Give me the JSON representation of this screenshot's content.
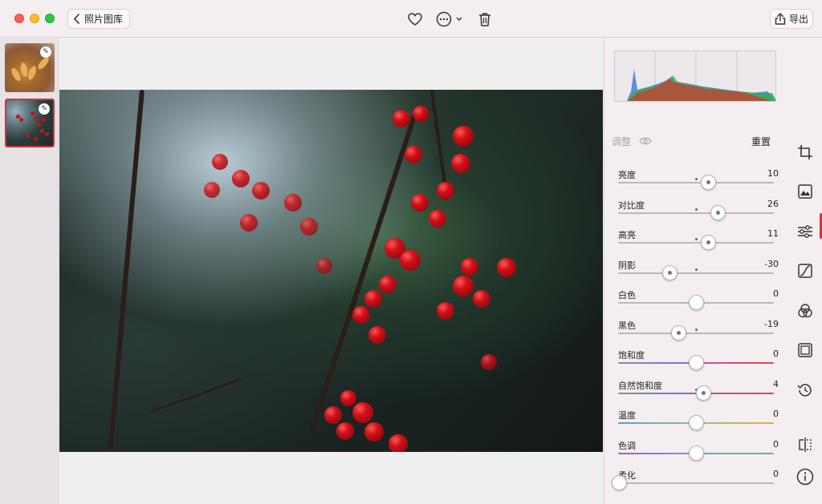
{
  "titlebar": {
    "back_label": "照片图库",
    "export_label": "导出",
    "icons": [
      "heart-icon",
      "more-icon",
      "trash-icon",
      "share-icon"
    ]
  },
  "panel": {
    "adjust_title": "调整",
    "reset_label": "重置",
    "sliders": [
      {
        "label": "亮度",
        "value": "10",
        "fraction": 0.58,
        "marked": true,
        "track": "#bdb7ba"
      },
      {
        "label": "对比度",
        "value": "26",
        "fraction": 0.64,
        "marked": true,
        "track": "#bdb7ba"
      },
      {
        "label": "高亮",
        "value": "11",
        "fraction": 0.58,
        "marked": true,
        "track": "#bdb7ba"
      },
      {
        "label": "阴影",
        "value": "-30",
        "fraction": 0.33,
        "marked": true,
        "track": "#bdb7ba"
      },
      {
        "label": "白色",
        "value": "0",
        "fraction": 0.5,
        "marked": false,
        "track": "#bdb7ba"
      },
      {
        "label": "黑色",
        "value": "-19",
        "fraction": 0.39,
        "marked": true,
        "track": "#bdb7ba"
      },
      {
        "label": "饱和度",
        "value": "0",
        "fraction": 0.5,
        "marked": false,
        "track": "saturation"
      },
      {
        "label": "自然饱和度",
        "value": "4",
        "fraction": 0.55,
        "marked": true,
        "track": "saturation"
      },
      {
        "label": "温度",
        "value": "0",
        "fraction": 0.5,
        "marked": false,
        "track": "temperature"
      },
      {
        "label": "色调",
        "value": "0",
        "fraction": 0.5,
        "marked": false,
        "track": "tint"
      },
      {
        "label": "柔化",
        "value": "0",
        "fraction": 0.0,
        "marked": false,
        "track": "#bdb7ba"
      }
    ]
  },
  "tools": [
    "crop-icon",
    "filters-icon",
    "adjust-icon",
    "curves-icon",
    "color-icon",
    "frame-icon",
    "history-icon",
    "compare-icon",
    "info-icon"
  ],
  "colors": {
    "accent": "#d9313c"
  }
}
